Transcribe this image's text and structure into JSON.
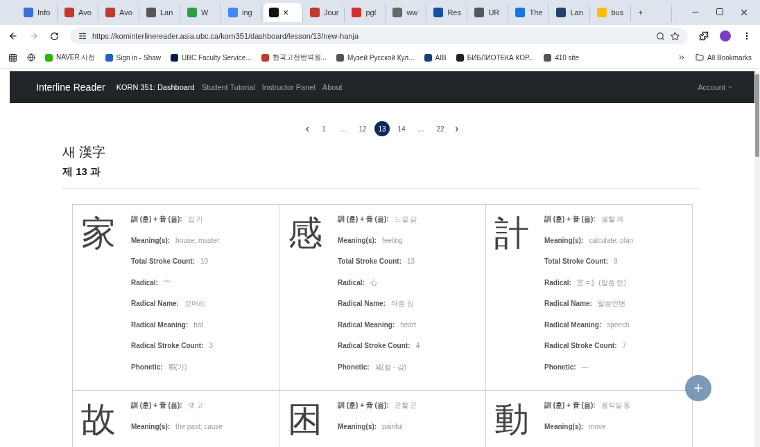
{
  "browser": {
    "tabs": [
      {
        "label": "Info",
        "selected": false,
        "color": "#3b6fd6"
      },
      {
        "label": "Avo",
        "selected": false,
        "color": "#c0392b"
      },
      {
        "label": "Avo",
        "selected": false,
        "color": "#c0392b"
      },
      {
        "label": "Lan",
        "selected": false,
        "color": "#555555"
      },
      {
        "label": "W",
        "selected": false,
        "color": "#2e9e3e"
      },
      {
        "label": "ing",
        "selected": false,
        "color": "#4285f4"
      },
      {
        "selected": true,
        "color": "#111111",
        "close": "×"
      },
      {
        "label": "Jour",
        "selected": false,
        "color": "#c0392b"
      },
      {
        "label": "pgl",
        "selected": false,
        "color": "#d32f2f"
      },
      {
        "label": "ww",
        "selected": false,
        "color": "#666666"
      },
      {
        "label": "Res",
        "selected": false,
        "color": "#1a4fa0"
      },
      {
        "label": "UR",
        "selected": false,
        "color": "#555555"
      },
      {
        "label": "The",
        "selected": false,
        "color": "#1a73e8"
      },
      {
        "label": "Lan",
        "selected": false,
        "color": "#24406e"
      },
      {
        "label": "bus",
        "selected": false,
        "color": "#fbbc05"
      }
    ],
    "new_tab": "+",
    "url": "https://kominterlinereader.asia.ubc.ca/korn351/dashboard/lesson/13/new-hanja",
    "bookmarks": [
      {
        "label": "NAVER 사전",
        "color": "#2db400"
      },
      {
        "label": "Sign in - Shaw",
        "color": "#1e63c6"
      },
      {
        "label": "UBC Faculty Service...",
        "color": "#002145"
      },
      {
        "label": "한국고전번역원...",
        "color": "#c0392b"
      },
      {
        "label": "Музей Русской Кул...",
        "color": "#555555"
      },
      {
        "label": "AIB",
        "color": "#1a3f7a"
      },
      {
        "label": "БИБЛИОТЕКА КОР...",
        "color": "#222222"
      },
      {
        "label": "410 site",
        "color": "#555555"
      }
    ],
    "all_bookmarks": "All Bookmarks"
  },
  "navbar": {
    "brand": "Interline Reader",
    "links": [
      {
        "label": "KORN 351: Dashboard",
        "selected": true
      },
      {
        "label": "Student Tutorial",
        "selected": false
      },
      {
        "label": "Instructor Panel",
        "selected": false
      },
      {
        "label": "About",
        "selected": false
      }
    ],
    "account": "Account"
  },
  "pagination": {
    "prev": "‹",
    "next": "›",
    "pages": [
      {
        "label": "1",
        "selected": false
      },
      {
        "label": "…",
        "selected": false
      },
      {
        "label": "12",
        "selected": false
      },
      {
        "label": "13",
        "selected": true
      },
      {
        "label": "14",
        "selected": false
      },
      {
        "label": "…",
        "selected": false
      },
      {
        "label": "22",
        "selected": false
      }
    ]
  },
  "title": "새 漢字",
  "subtitle": "제 13 과",
  "cards": [
    {
      "hanja": "家",
      "fields": [
        {
          "label": "訓 (훈) + 音 (음):",
          "value": "집 가"
        },
        {
          "label": "Meaning(s):",
          "value": "house; master"
        },
        {
          "label": "Total Stroke Count:",
          "value": "10"
        },
        {
          "label": "Radical:",
          "value": "宀"
        },
        {
          "label": "Radical Name:",
          "value": "갓머리"
        },
        {
          "label": "Radical Meaning:",
          "value": "hat"
        },
        {
          "label": "Radical Stroke Count:",
          "value": "3"
        },
        {
          "label": "Phonetic:",
          "value": "豭(가)"
        }
      ]
    },
    {
      "hanja": "感",
      "fields": [
        {
          "label": "訓 (훈) + 音 (음):",
          "value": "느낄 감"
        },
        {
          "label": "Meaning(s):",
          "value": "feeling"
        },
        {
          "label": "Total Stroke Count:",
          "value": "13"
        },
        {
          "label": "Radical:",
          "value": "心"
        },
        {
          "label": "Radical Name:",
          "value": "마음 심"
        },
        {
          "label": "Radical Meaning:",
          "value": "heart"
        },
        {
          "label": "Radical Stroke Count:",
          "value": "4"
        },
        {
          "label": "Phonetic:",
          "value": "咸(함 - 감)"
        }
      ]
    },
    {
      "hanja": "計",
      "fields": [
        {
          "label": "訓 (훈) + 音 (음):",
          "value": "셈할 계"
        },
        {
          "label": "Meaning(s):",
          "value": "calculate; plan"
        },
        {
          "label": "Total Stroke Count:",
          "value": "9"
        },
        {
          "label": "Radical:",
          "value": "言 = 訁(말씀 언)"
        },
        {
          "label": "Radical Name:",
          "value": "말씀언변"
        },
        {
          "label": "Radical Meaning:",
          "value": "speech"
        },
        {
          "label": "Radical Stroke Count:",
          "value": "7"
        },
        {
          "label": "Phonetic:",
          "value": "—"
        }
      ]
    },
    {
      "hanja": "故",
      "fields": [
        {
          "label": "訓 (훈) + 音 (음):",
          "value": "옛 고"
        },
        {
          "label": "Meaning(s):",
          "value": "the past; cause"
        }
      ]
    },
    {
      "hanja": "困",
      "fields": [
        {
          "label": "訓 (훈) + 音 (음):",
          "value": "곤할 곤"
        },
        {
          "label": "Meaning(s):",
          "value": "painful"
        }
      ]
    },
    {
      "hanja": "動",
      "fields": [
        {
          "label": "訓 (훈) + 音 (음):",
          "value": "움직일 동"
        },
        {
          "label": "Meaning(s):",
          "value": "move"
        }
      ]
    }
  ]
}
